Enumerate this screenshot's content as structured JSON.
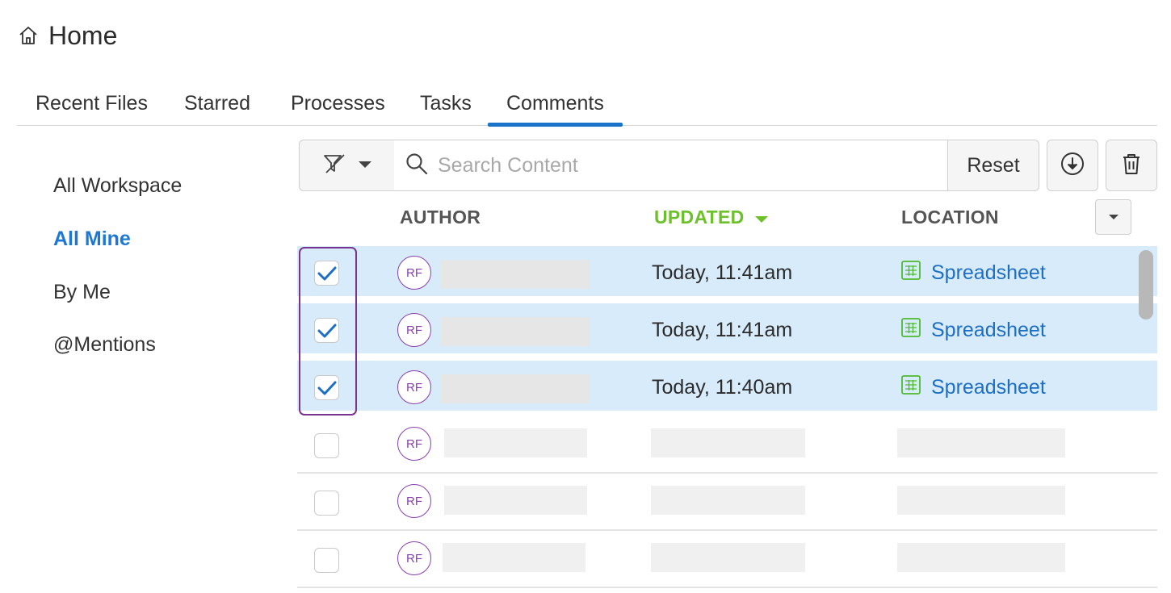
{
  "header": {
    "title": "Home",
    "icon": "home-icon"
  },
  "tabs": [
    {
      "label": "Recent Files",
      "active": false
    },
    {
      "label": "Starred",
      "active": false
    },
    {
      "label": "Processes",
      "active": false
    },
    {
      "label": "Tasks",
      "active": false
    },
    {
      "label": "Comments",
      "active": true
    }
  ],
  "sidebar": {
    "items": [
      {
        "label": "All Workspace",
        "active": false
      },
      {
        "label": "All Mine",
        "active": true
      },
      {
        "label": "By Me",
        "active": false
      },
      {
        "label": "@Mentions",
        "active": false
      }
    ]
  },
  "toolbar": {
    "search_placeholder": "Search Content",
    "search_value": "",
    "reset_label": "Reset",
    "filter_icon": "filter-icon",
    "download_icon": "download-icon",
    "delete_icon": "trash-icon"
  },
  "columns": {
    "author": "AUTHOR",
    "updated": "UPDATED",
    "location": "LOCATION",
    "sorted_column": "updated",
    "sort_direction": "descending"
  },
  "rows": [
    {
      "selected": true,
      "avatar": "RF",
      "updated": "Today, 11:41am",
      "location": "Spreadsheet"
    },
    {
      "selected": true,
      "avatar": "RF",
      "updated": "Today, 11:41am",
      "location": "Spreadsheet"
    },
    {
      "selected": true,
      "avatar": "RF",
      "updated": "Today, 11:40am",
      "location": "Spreadsheet"
    },
    {
      "selected": false,
      "avatar": "RF",
      "updated": "",
      "location": ""
    },
    {
      "selected": false,
      "avatar": "RF",
      "updated": "",
      "location": ""
    },
    {
      "selected": false,
      "avatar": "RF",
      "updated": "",
      "location": ""
    }
  ],
  "colors": {
    "accent": "#1a73c8",
    "sort_green": "#6cc02a",
    "selected_row": "#d8ebfb",
    "avatar_purple": "#8a3fb0",
    "link_blue": "#1c6fc4",
    "selection_frame": "#7a3390"
  }
}
